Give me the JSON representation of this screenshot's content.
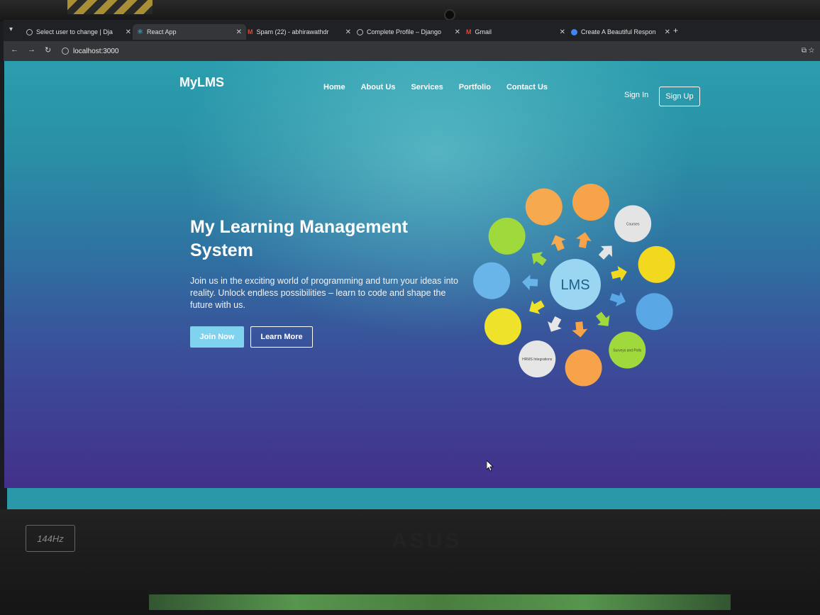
{
  "browser": {
    "tabs": [
      {
        "title": "Select user to change | Dja",
        "icon": "globe-icon"
      },
      {
        "title": "React App",
        "icon": "react-icon"
      },
      {
        "title": "Spam (22) - abhirawathdr",
        "icon": "gmail-icon"
      },
      {
        "title": "Complete Profile – Django",
        "icon": "globe-icon"
      },
      {
        "title": "Gmail",
        "icon": "gmail-icon"
      },
      {
        "title": "Create A Beautiful Respon",
        "icon": "blue-circle-icon"
      }
    ],
    "url": "localhost:3000"
  },
  "site": {
    "brand": "MyLMS",
    "nav": [
      "Home",
      "About Us",
      "Services",
      "Portfolio",
      "Contact Us"
    ],
    "sign_in": "Sign In",
    "sign_up": "Sign Up"
  },
  "hero": {
    "title": "My Learning Management System",
    "text": "Join us in the exciting world of programming and turn your ideas into reality. Unlock endless possibilities – learn to code and shape the future with us.",
    "join_button": "Join Now",
    "learn_button": "Learn More"
  },
  "diagram": {
    "center": "LMS",
    "nodes": [
      {
        "label": "",
        "color": "#f7a950"
      },
      {
        "label": "",
        "color": "#f7a34a"
      },
      {
        "label": "Courses",
        "color": "#e4e4e4"
      },
      {
        "label": "",
        "color": "#f2d81e"
      },
      {
        "label": "",
        "color": "#5aa7e6"
      },
      {
        "label": "Surveys and Polls",
        "color": "#9fd93c"
      },
      {
        "label": "",
        "color": "#f7a34a"
      },
      {
        "label": "HRMS Integrations",
        "color": "#e6e6e6"
      },
      {
        "label": "",
        "color": "#eee32a"
      },
      {
        "label": "",
        "color": "#69b4e8"
      },
      {
        "label": "",
        "color": "#9fd93c"
      }
    ]
  },
  "laptop": {
    "refresh_badge": "144Hz",
    "logo": "ASUS"
  }
}
